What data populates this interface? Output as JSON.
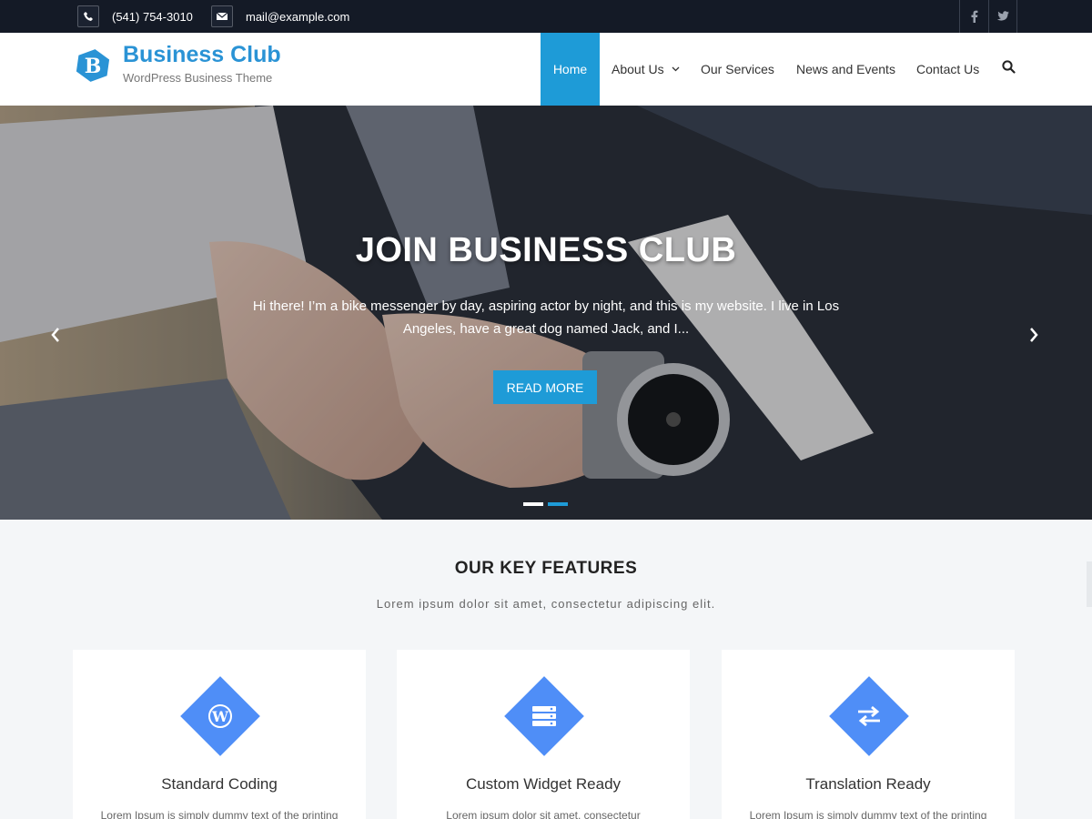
{
  "topbar": {
    "phone": "(541) 754-3010",
    "email": "mail@example.com",
    "social": [
      "facebook-icon",
      "twitter-icon"
    ]
  },
  "header": {
    "site_title": "Business Club",
    "tagline": "WordPress Business Theme",
    "logo_letter": "B",
    "nav": [
      "Home",
      "About Us",
      "Our Services",
      "News and Events",
      "Contact Us"
    ]
  },
  "hero": {
    "title": "JOIN BUSINESS CLUB",
    "text": "Hi there! I’m a bike messenger by day, aspiring actor by night, and this is my website. I live in Los Angeles, have a great dog named Jack, and I...",
    "button": "READ MORE",
    "active_slide": 2,
    "slide_count": 2
  },
  "features": {
    "title": "OUR KEY FEATURES",
    "subtitle": "Lorem ipsum dolor sit amet, consectetur adipiscing elit.",
    "cards": [
      {
        "icon": "wordpress-icon",
        "title": "Standard Coding",
        "text": "Lorem Ipsum is simply dummy text of the printing"
      },
      {
        "icon": "server-icon",
        "title": "Custom Widget Ready",
        "text": "Lorem ipsum dolor sit amet, consectetur"
      },
      {
        "icon": "exchange-icon",
        "title": "Translation Ready",
        "text": "Lorem Ipsum is simply dummy text of the printing"
      }
    ]
  },
  "colors": {
    "accent": "#1e9bd7",
    "topbar": "#141a26",
    "feature_icon": "#4f8ef7"
  }
}
